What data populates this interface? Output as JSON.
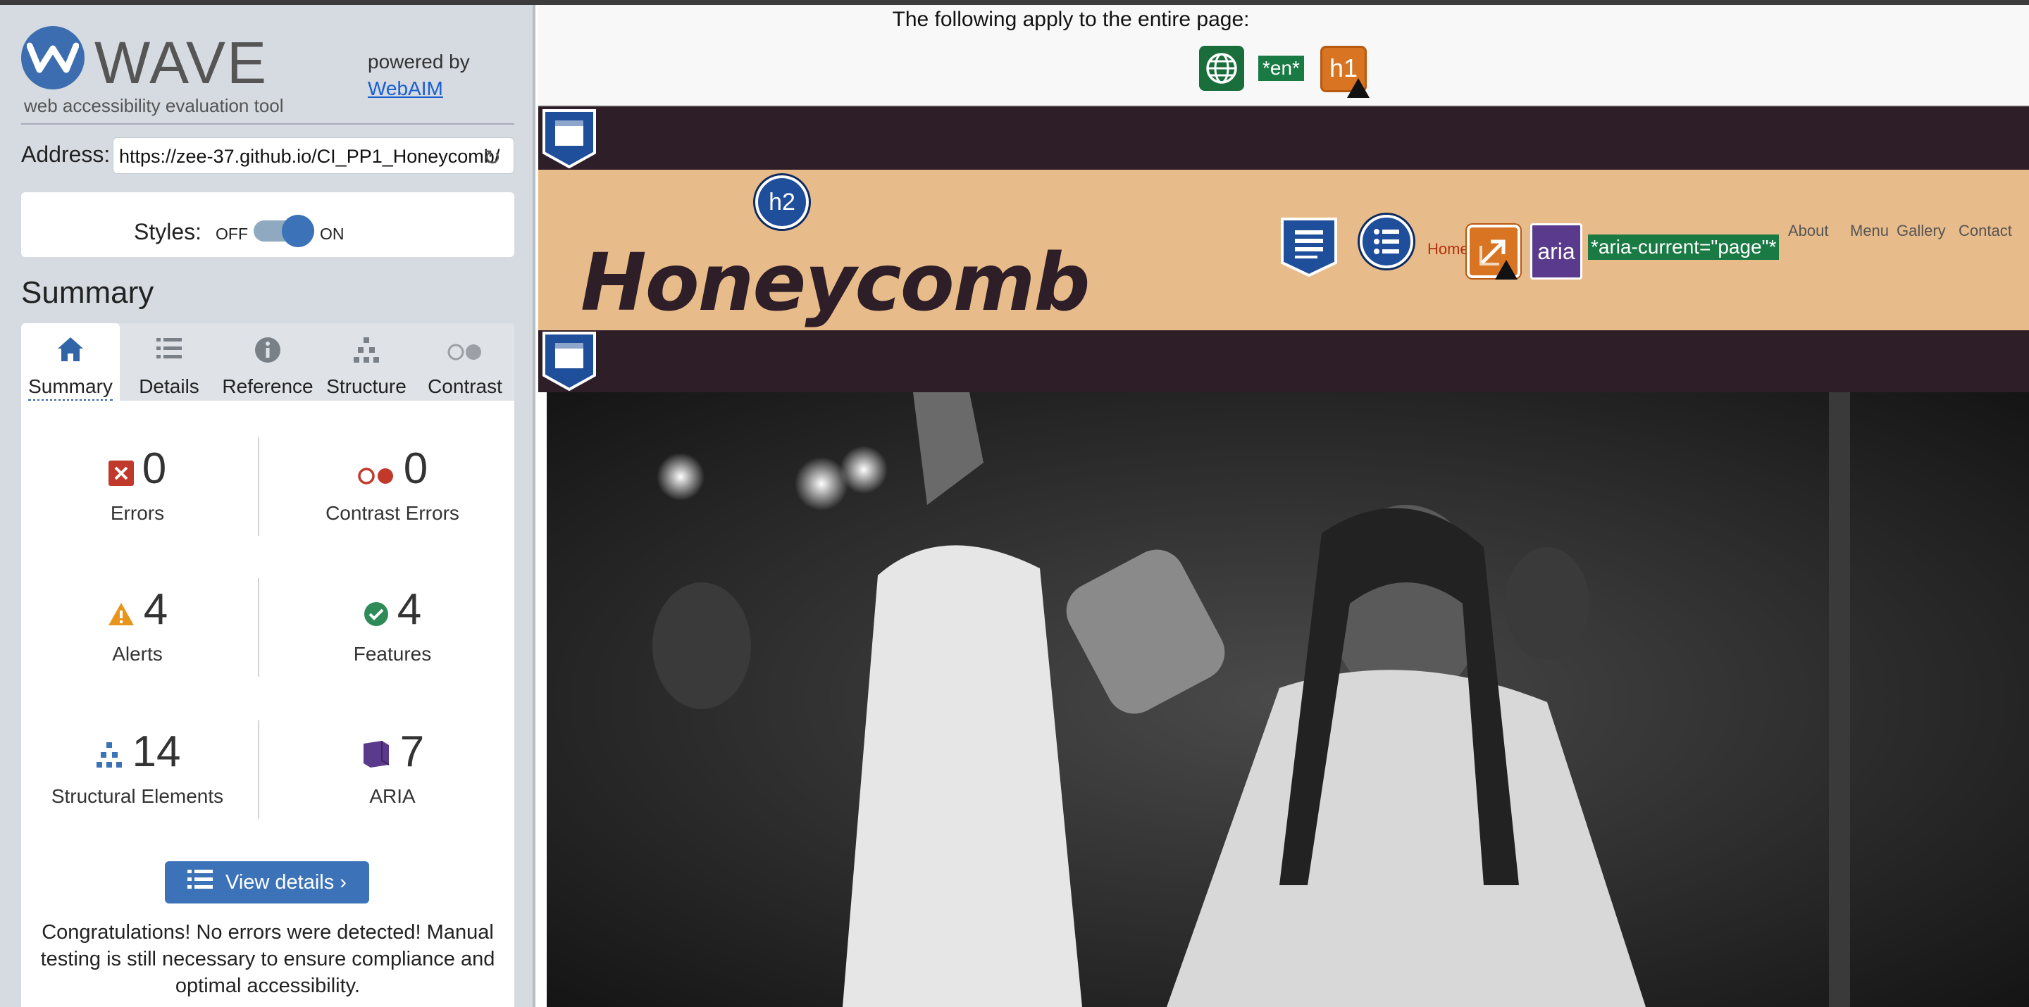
{
  "sidebar": {
    "app_name": "WAVE",
    "tagline": "web accessibility evaluation tool",
    "powered_by": "powered by",
    "powered_link": "WebAIM",
    "address_label": "Address:",
    "address_value": "https://zee-37.github.io/CI_PP1_Honeycomb/",
    "styles_label": "Styles:",
    "styles_off": "OFF",
    "styles_on": "ON",
    "styles_state": "on",
    "summary_title": "Summary",
    "tabs": [
      {
        "label": "Summary",
        "icon": "home-icon",
        "active": true
      },
      {
        "label": "Details",
        "icon": "list-icon",
        "active": false
      },
      {
        "label": "Reference",
        "icon": "info-icon",
        "active": false
      },
      {
        "label": "Structure",
        "icon": "structure-icon",
        "active": false
      },
      {
        "label": "Contrast",
        "icon": "contrast-icon",
        "active": false
      }
    ],
    "stats": {
      "errors": {
        "value": "0",
        "label": "Errors"
      },
      "contrast_errors": {
        "value": "0",
        "label": "Contrast Errors"
      },
      "alerts": {
        "value": "4",
        "label": "Alerts"
      },
      "features": {
        "value": "4",
        "label": "Features"
      },
      "structural": {
        "value": "14",
        "label": "Structural Elements"
      },
      "aria": {
        "value": "7",
        "label": "ARIA"
      }
    },
    "view_details": "View details ›",
    "congrats": "Congratulations! No errors were detected! Manual testing is still necessary to ensure compliance and optimal accessibility."
  },
  "content": {
    "apply_text": "The following apply to the entire page:",
    "lang_badge": "*en*",
    "h1_badge": "h1",
    "h2_badge": "h2",
    "aria_badge": "aria",
    "aria_current": "*aria-current=\"page\"*",
    "site_title": "Honeycomb",
    "nav": {
      "home": "Home",
      "about": "About",
      "menu": "Menu",
      "gallery": "Gallery",
      "contact": "Contact"
    }
  },
  "colors": {
    "wave_blue": "#3c72b8",
    "error_red": "#c0392b",
    "alert_orange": "#e8951e",
    "feature_green": "#2e8b57",
    "aria_purple": "#5a3a8c",
    "header_tan": "#e8bb8a",
    "dark_band": "#2e1e27"
  }
}
